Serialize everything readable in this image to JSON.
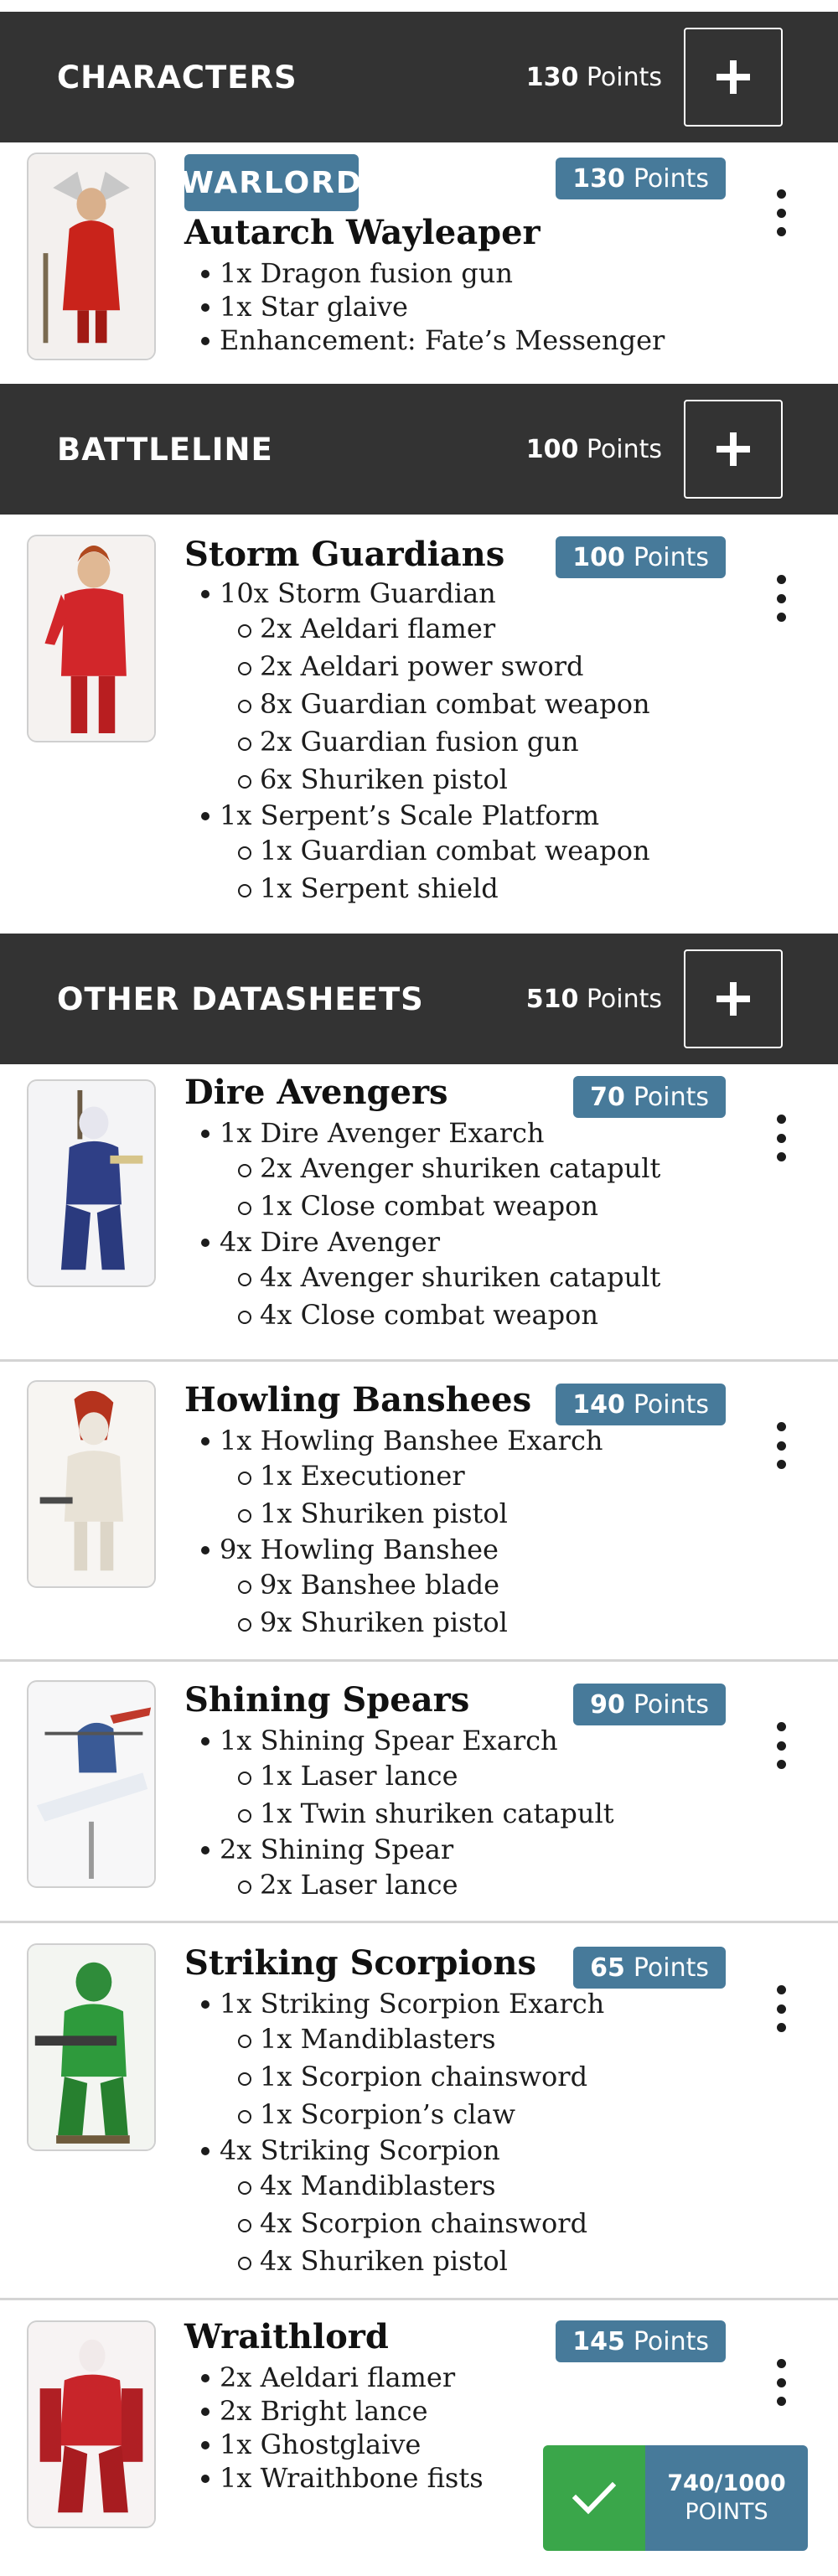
{
  "sections": {
    "characters": {
      "title": "CHARACTERS",
      "points_value": "130",
      "points_label": "Points"
    },
    "battleline": {
      "title": "BATTLELINE",
      "points_value": "100",
      "points_label": "Points"
    },
    "other": {
      "title": "OTHER DATASHEETS",
      "points_value": "510",
      "points_label": "Points"
    }
  },
  "warlord_label": "WARLORD",
  "units": [
    {
      "name": "Autarch Wayleaper",
      "points_value": "130",
      "points_label": "Points",
      "lines": [
        "1x Dragon fusion gun",
        "1x Star glaive",
        "Enhancement: Fate’s Messenger"
      ]
    },
    {
      "name": "Storm Guardians",
      "points_value": "100",
      "points_label": "Points",
      "lines": [
        "10x Storm Guardian",
        "2x Aeldari flamer",
        "2x Aeldari power sword",
        "8x Guardian combat weapon",
        "2x Guardian fusion gun",
        "6x Shuriken pistol",
        "1x Serpent’s Scale Platform",
        "1x Guardian combat weapon",
        "1x Serpent shield"
      ]
    },
    {
      "name": "Dire Avengers",
      "points_value": "70",
      "points_label": "Points",
      "lines": [
        "1x Dire Avenger Exarch",
        "2x Avenger shuriken catapult",
        "1x Close combat weapon",
        "4x Dire Avenger",
        "4x Avenger shuriken catapult",
        "4x Close combat weapon"
      ]
    },
    {
      "name": "Howling Banshees",
      "points_value": "140",
      "points_label": "Points",
      "lines": [
        "1x Howling Banshee Exarch",
        "1x Executioner",
        "1x Shuriken pistol",
        "9x Howling Banshee",
        "9x Banshee blade",
        "9x Shuriken pistol"
      ]
    },
    {
      "name": "Shining Spears",
      "points_value": "90",
      "points_label": "Points",
      "lines": [
        "1x Shining Spear Exarch",
        "1x Laser lance",
        "1x Twin shuriken catapult",
        "2x Shining Spear",
        "2x Laser lance"
      ]
    },
    {
      "name": "Striking Scorpions",
      "points_value": "65",
      "points_label": "Points",
      "lines": [
        "1x Striking Scorpion Exarch",
        "1x Mandiblasters",
        "1x Scorpion chainsword",
        "1x Scorpion’s claw",
        "4x Striking Scorpion",
        "4x Mandiblasters",
        "4x Scorpion chainsword",
        "4x Shuriken pistol"
      ]
    },
    {
      "name": "Wraithlord",
      "points_value": "145",
      "points_label": "Points",
      "lines": [
        "2x Aeldari flamer",
        "2x Bright lance",
        "1x Ghostglaive",
        "1x Wraithbone fists"
      ]
    }
  ],
  "total": {
    "value": "740/1000",
    "label": "POINTS"
  },
  "colors": {
    "header_bg": "#333333",
    "badge": "#477a9a",
    "confirm": "#3aa64a"
  }
}
